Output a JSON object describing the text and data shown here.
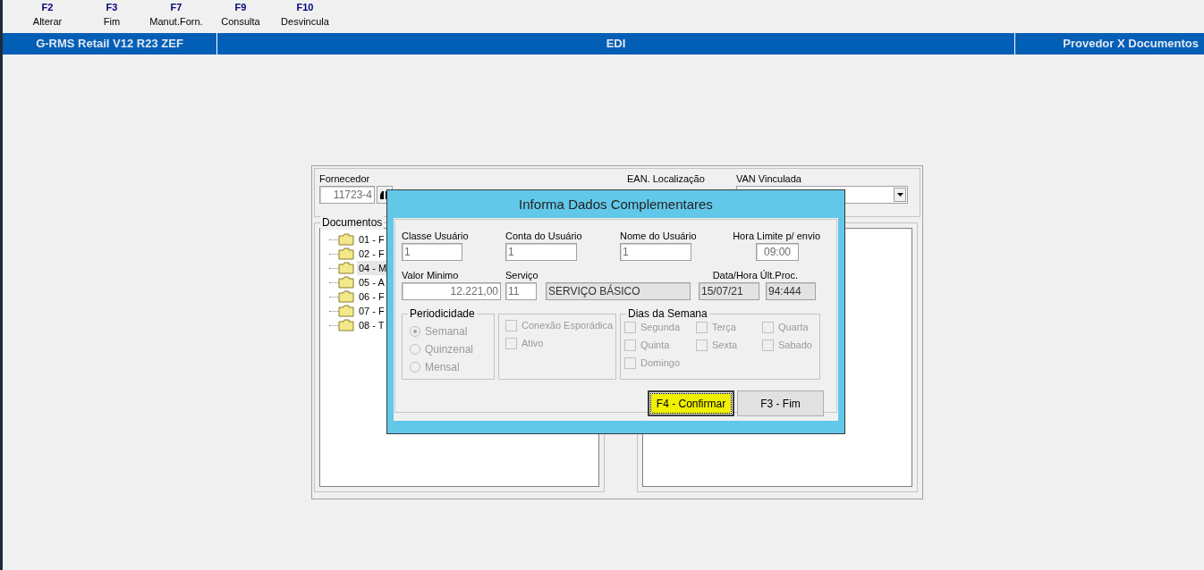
{
  "toolbar": [
    {
      "key": "F2",
      "label": "Alterar"
    },
    {
      "key": "F3",
      "label": "Fim"
    },
    {
      "key": "F7",
      "label": "Manut.Forn."
    },
    {
      "key": "F9",
      "label": "Consulta"
    },
    {
      "key": "F10",
      "label": "Desvincula"
    }
  ],
  "header": {
    "system": "G-RMS Retail V12 R23 ZEF",
    "module": "EDI",
    "screen": "Provedor X Documentos"
  },
  "supplier": {
    "label": "Fornecedor",
    "code": "11723-4",
    "ean_label": "EAN. Localização",
    "van_label": "VAN Vinculada"
  },
  "documents": {
    "label": "Documentos",
    "items": [
      {
        "text": "01 - F",
        "selected": false
      },
      {
        "text": "02 - F",
        "selected": false
      },
      {
        "text": "04 - M",
        "selected": true
      },
      {
        "text": "05 - A",
        "selected": false
      },
      {
        "text": "06 - F",
        "selected": false
      },
      {
        "text": "07 - F",
        "selected": false
      },
      {
        "text": "08 - T",
        "selected": false
      }
    ]
  },
  "dialog": {
    "title": "Informa Dados Complementares",
    "fields_row1": [
      {
        "label": "Classe Usuário",
        "value": "1",
        "readonly": false
      },
      {
        "label": "Conta do Usuário",
        "value": "1",
        "readonly": false
      },
      {
        "label": "Nome do Usuário",
        "value": "1",
        "readonly": false
      },
      {
        "label": "Hora Limite p/ envio",
        "value": "09:00",
        "readonly": false
      }
    ],
    "valor": {
      "label": "Valor Minimo",
      "value": "12.221,00",
      "readonly": false
    },
    "servico": {
      "label": "Serviço",
      "code": "11",
      "description": "SERVIÇO BÁSICO"
    },
    "last_proc": {
      "label": "Data/Hora Últ.Proc.",
      "date": "15/07/21",
      "time": "94:444"
    },
    "periodicity": {
      "label": "Periodicidade",
      "options": [
        {
          "label": "Semanal",
          "selected": true
        },
        {
          "label": "Quinzenal",
          "selected": false
        },
        {
          "label": "Mensal",
          "selected": false
        }
      ]
    },
    "connection": [
      {
        "label": "Conexão Esporádica",
        "checked": false
      },
      {
        "label": "Ativo",
        "checked": false
      }
    ],
    "weekdays": {
      "label": "Dias da Semana",
      "days": [
        {
          "label": "Segunda",
          "checked": false
        },
        {
          "label": "Terça",
          "checked": false
        },
        {
          "label": "Quarta",
          "checked": false
        },
        {
          "label": "Quinta",
          "checked": false
        },
        {
          "label": "Sexta",
          "checked": false
        },
        {
          "label": "Sabado",
          "checked": false
        },
        {
          "label": "Domingo",
          "checked": false
        }
      ]
    },
    "buttons": [
      {
        "label": "F4 - Confirmar",
        "focused": true,
        "highlighted": true
      },
      {
        "label": "F3 - Fim",
        "focused": false,
        "highlighted": false
      }
    ]
  }
}
